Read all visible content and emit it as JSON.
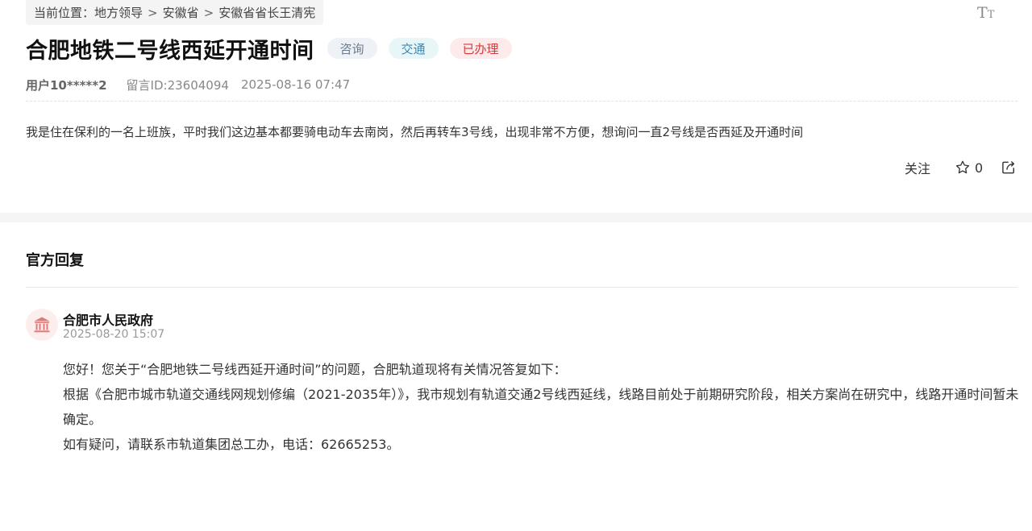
{
  "breadcrumb": {
    "prefix": "当前位置：",
    "items": [
      "地方领导",
      "安徽省",
      "安徽省省长王清宪"
    ],
    "separator": ">"
  },
  "font_size_toggle": {
    "big": "T",
    "small": "T"
  },
  "question": {
    "title": "合肥地铁二号线西延开通时间",
    "tags": [
      "咨询",
      "交通",
      "已办理"
    ],
    "user": "用户10*****2",
    "message_id": "留言ID:23604094",
    "time": "2025-08-16 07:47",
    "content": "我是住在保利的一名上班族，平时我们这边基本都要骑电动车去南岗，然后再转车3号线，出现非常不方便，想询问一直2号线是否西延及开通时间"
  },
  "actions": {
    "follow_label": "关注",
    "favorite_count": "0"
  },
  "reply": {
    "heading": "官方回复",
    "org_name": "合肥市人民政府",
    "time": "2025-08-20 15:07",
    "paragraphs": [
      "您好！您关于“合肥地铁二号线西延开通时间”的问题，合肥轨道现将有关情况答复如下：",
      "根据《合肥市城市轨道交通线网规划修编（2021-2035年）》，我市规划有轨道交通2号线西延线，线路目前处于前期研究阶段，相关方案尚在研究中，线路开通时间暂未确定。",
      "如有疑问，请联系市轨道集团总工办，电话：62665253。"
    ]
  },
  "colors": {
    "tag_consult_bg": "#eef1f6",
    "tag_traffic_bg": "#e9f6f7",
    "tag_done_bg": "#fdeaea",
    "tag_done_text": "#d63b3b",
    "org_icon": "#e07a7a"
  },
  "icons": {
    "font_size": "font-size-icon",
    "star": "star-icon",
    "share": "share-icon",
    "org": "government-building-icon"
  }
}
